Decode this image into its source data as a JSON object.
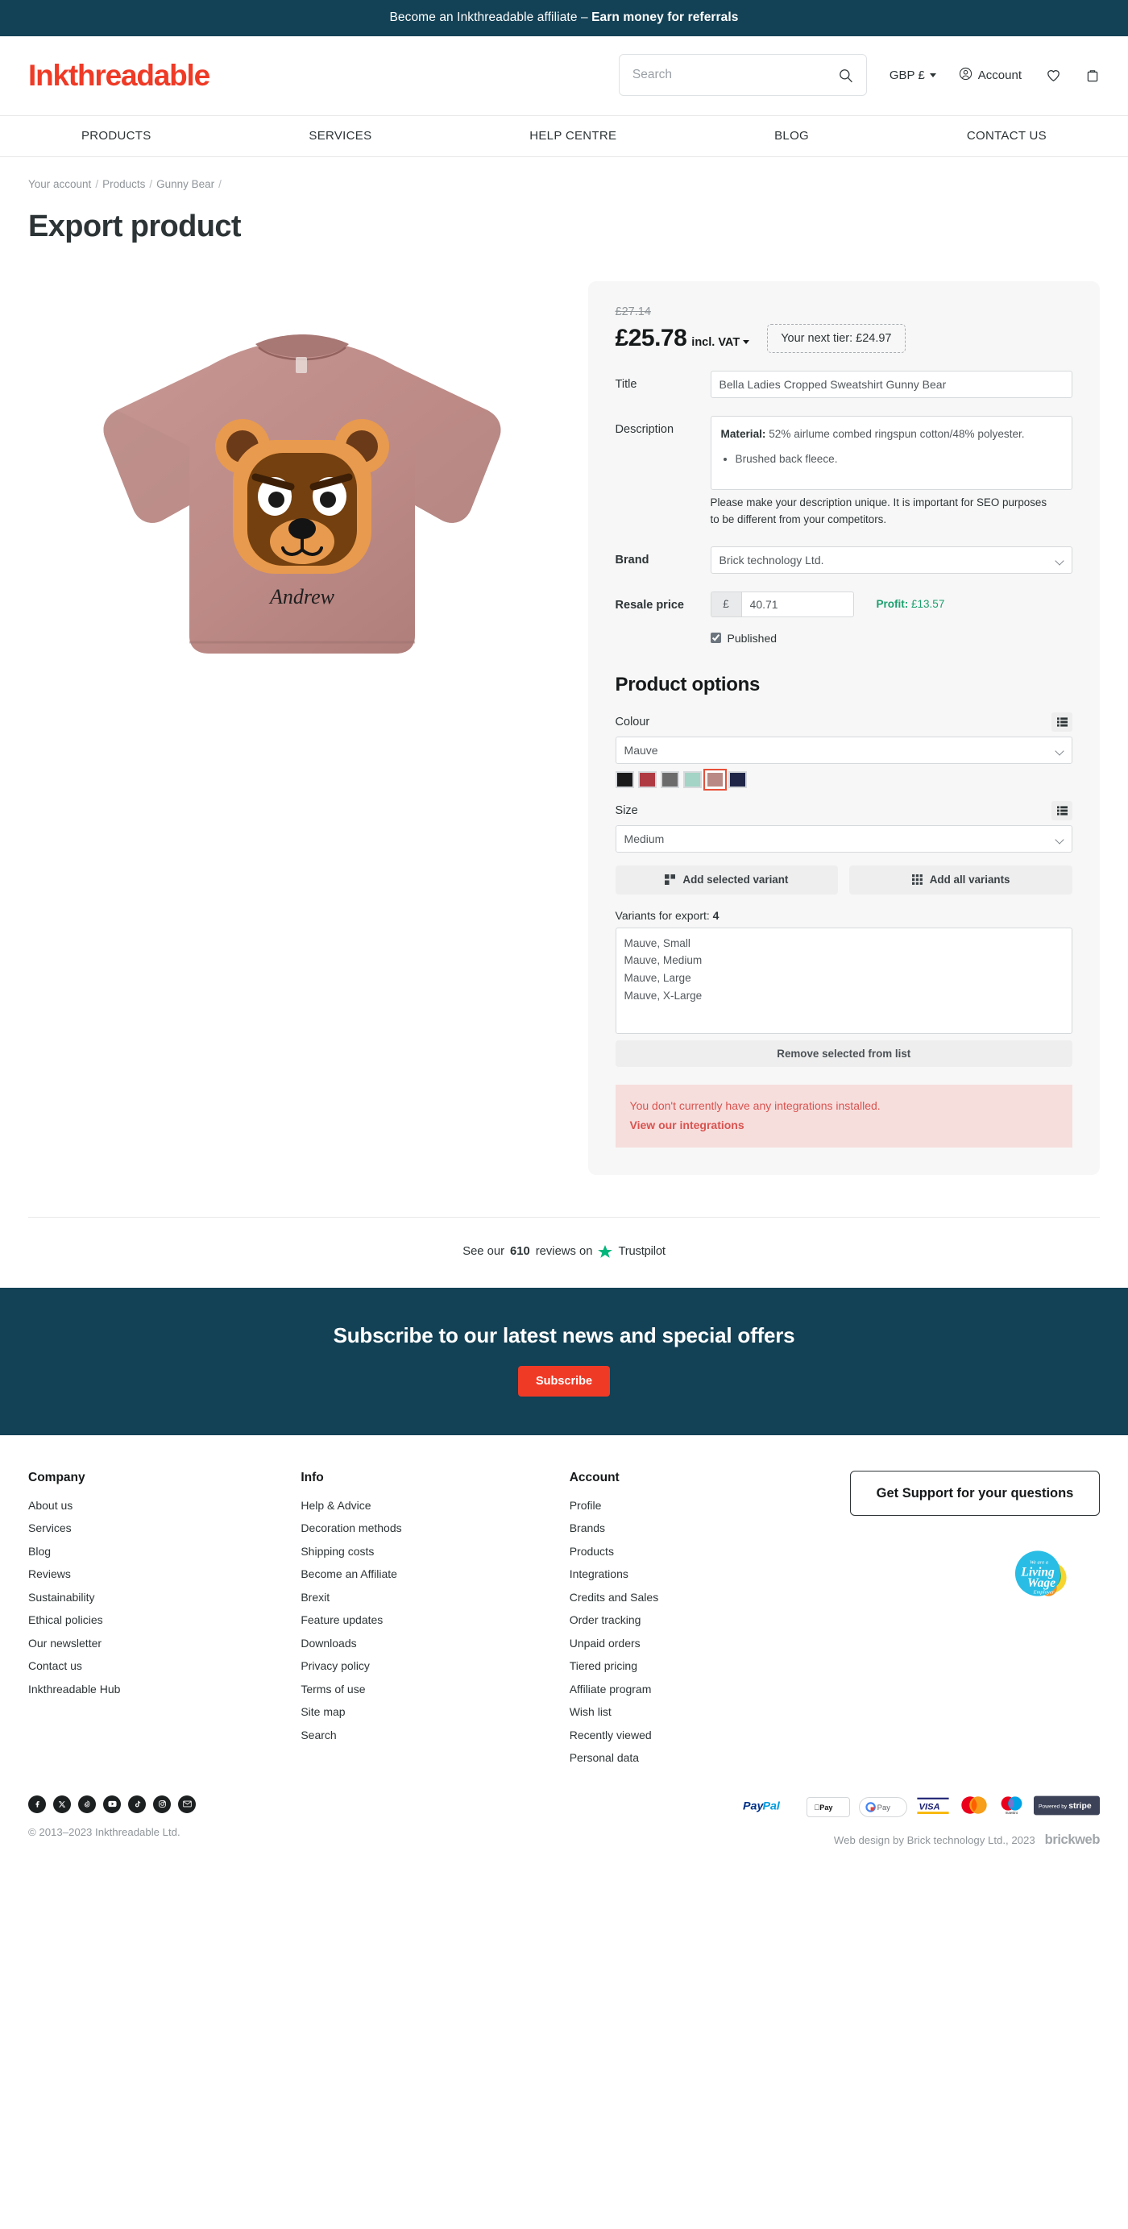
{
  "affiliate_bar": {
    "text": "Become an Inkthreadable affiliate – ",
    "link": "Earn money for referrals"
  },
  "header": {
    "logo": "Inkthreadable",
    "search_placeholder": "Search",
    "search_value": "",
    "currency": "GBP £",
    "account": "Account",
    "icons": [
      "search-icon",
      "heart-icon",
      "bag-icon"
    ]
  },
  "nav": {
    "items": [
      "PRODUCTS",
      "SERVICES",
      "HELP CENTRE",
      "BLOG",
      "CONTACT US"
    ]
  },
  "breadcrumb": {
    "items": [
      "Your account",
      "Products",
      "Gunny Bear"
    ],
    "separator": "/"
  },
  "page": {
    "title": "Export product"
  },
  "product": {
    "image_alt": "Mauve Bella Ladies Cropped Sweatshirt with Gunny Bear print",
    "price_old": "£27.14",
    "price_now": "£25.78",
    "price_vat_label": "incl. VAT",
    "tier_badge": "Your next tier: £24.97",
    "fields": {
      "title_label": "Title",
      "title_value": "Bella Ladies Cropped Sweatshirt Gunny Bear",
      "description_label": "Description",
      "description_material_label": "Material:",
      "description_material_value": " 52% airlume combed ringspun cotton/48% polyester.",
      "description_bullets": [
        "Brushed back fleece."
      ],
      "description_help": "Please make your description unique. It is important for SEO purposes to be different from your competitors.",
      "brand_label": "Brand",
      "brand_value": "Brick technology Ltd.",
      "resale_label": "Resale price",
      "resale_currency": "£",
      "resale_value": "40.71",
      "profit_label": "Profit:",
      "profit_value": " £13.57",
      "published_label": "Published",
      "published_checked": true
    }
  },
  "options": {
    "heading": "Product options",
    "colour_label": "Colour",
    "colour_value": "Mauve",
    "swatches": [
      {
        "name": "Black",
        "hex": "#1a1a1a",
        "selected": false
      },
      {
        "name": "Red",
        "hex": "#b03a42",
        "selected": false
      },
      {
        "name": "Grey",
        "hex": "#6b6b6b",
        "selected": false
      },
      {
        "name": "Mint",
        "hex": "#a3d4c5",
        "selected": false
      },
      {
        "name": "Mauve",
        "hex": "#b98a85",
        "selected": true
      },
      {
        "name": "Navy",
        "hex": "#1e2547",
        "selected": false
      }
    ],
    "size_label": "Size",
    "size_value": "Medium",
    "add_selected_label": "Add selected variant",
    "add_all_label": "Add all variants",
    "variants_count_label": "Variants for export: ",
    "variants_count": "4",
    "variants": [
      "Mauve, Small",
      "Mauve, Medium",
      "Mauve, Large",
      "Mauve, X-Large"
    ],
    "remove_label": "Remove selected from list"
  },
  "alert": {
    "message": "You don't currently have any integrations installed.",
    "link": "View our integrations",
    "color": "#d9534f",
    "bg": "#f6dedd"
  },
  "trustpilot": {
    "prefix": "See our ",
    "count": "610",
    "middle": " reviews on ",
    "brand": "Trustpilot",
    "star_color": "#00b67a"
  },
  "subscribe": {
    "heading": "Subscribe to our latest news and special offers",
    "button": "Subscribe",
    "bg": "#134155",
    "button_color": "#ef3a26"
  },
  "footer": {
    "columns": [
      {
        "heading": "Company",
        "links": [
          "About us",
          "Services",
          "Blog",
          "Reviews",
          "Sustainability",
          "Ethical policies",
          "Our newsletter",
          "Contact us",
          "Inkthreadable Hub"
        ]
      },
      {
        "heading": "Info",
        "links": [
          "Help & Advice",
          "Decoration methods",
          "Shipping costs",
          "Become an Affiliate",
          "Brexit",
          "Feature updates",
          "Downloads",
          "Privacy policy",
          "Terms of use",
          "Site map",
          "Search"
        ]
      },
      {
        "heading": "Account",
        "links": [
          "Profile",
          "Brands",
          "Products",
          "Integrations",
          "Credits and Sales",
          "Order tracking",
          "Unpaid orders",
          "Tiered pricing",
          "Affiliate program",
          "Wish list",
          "Recently viewed",
          "Personal data"
        ]
      }
    ],
    "support_button": "Get Support for your questions",
    "living_wage": {
      "line1": "We are a",
      "line2": "Living",
      "line3": "Wage",
      "line4": "Employer"
    },
    "socials": [
      "facebook-icon",
      "x-twitter-icon",
      "threads-icon",
      "youtube-icon",
      "tiktok-icon",
      "instagram-icon",
      "email-icon"
    ],
    "copyright": "© 2013–2023 Inkthreadable Ltd.",
    "payments": [
      "PayPal",
      "Apple Pay",
      "G Pay",
      "VISA",
      "Mastercard",
      "Maestro",
      "Powered by stripe"
    ],
    "webdesign": "Web design by Brick technology Ltd., 2023",
    "brickweb": "brickweb"
  }
}
